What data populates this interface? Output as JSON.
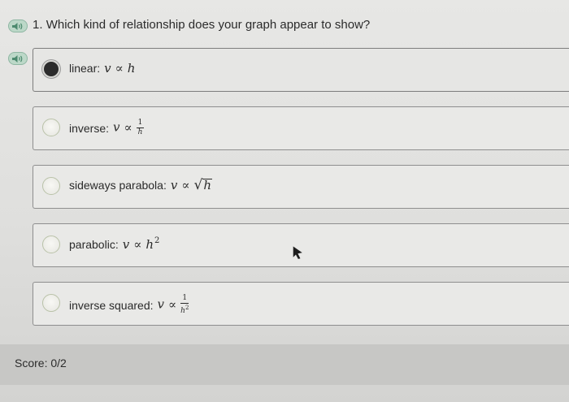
{
  "question": {
    "number": "1.",
    "text": "Which kind of relationship does your graph appear to show?"
  },
  "options": [
    {
      "label": "linear:",
      "math_lhs": "v",
      "symbol": "∝",
      "math_rhs": "h",
      "selected": true
    },
    {
      "label": "inverse:",
      "math_lhs": "v",
      "symbol": "∝",
      "frac_num": "1",
      "frac_den": "h",
      "selected": false
    },
    {
      "label": "sideways parabola:",
      "math_lhs": "v",
      "symbol": "∝",
      "radical": "√",
      "radicand": "h",
      "selected": false
    },
    {
      "label": "parabolic:",
      "math_lhs": "v",
      "symbol": "∝",
      "math_rhs": "h",
      "exponent": "2",
      "selected": false
    },
    {
      "label": "inverse squared:",
      "math_lhs": "v",
      "symbol": "∝",
      "frac_num": "1",
      "frac_den": "h",
      "frac_den_exp": "2",
      "selected": false
    }
  ],
  "score": {
    "label": "Score:",
    "value": "0/2"
  },
  "icons": {
    "speaker": "speaker-icon",
    "cursor": "mouse-cursor-icon"
  },
  "colors": {
    "speaker_fill": "#bcd8c8",
    "speaker_border": "#8fb7a3",
    "selected_radio": "#2c2c2c"
  }
}
